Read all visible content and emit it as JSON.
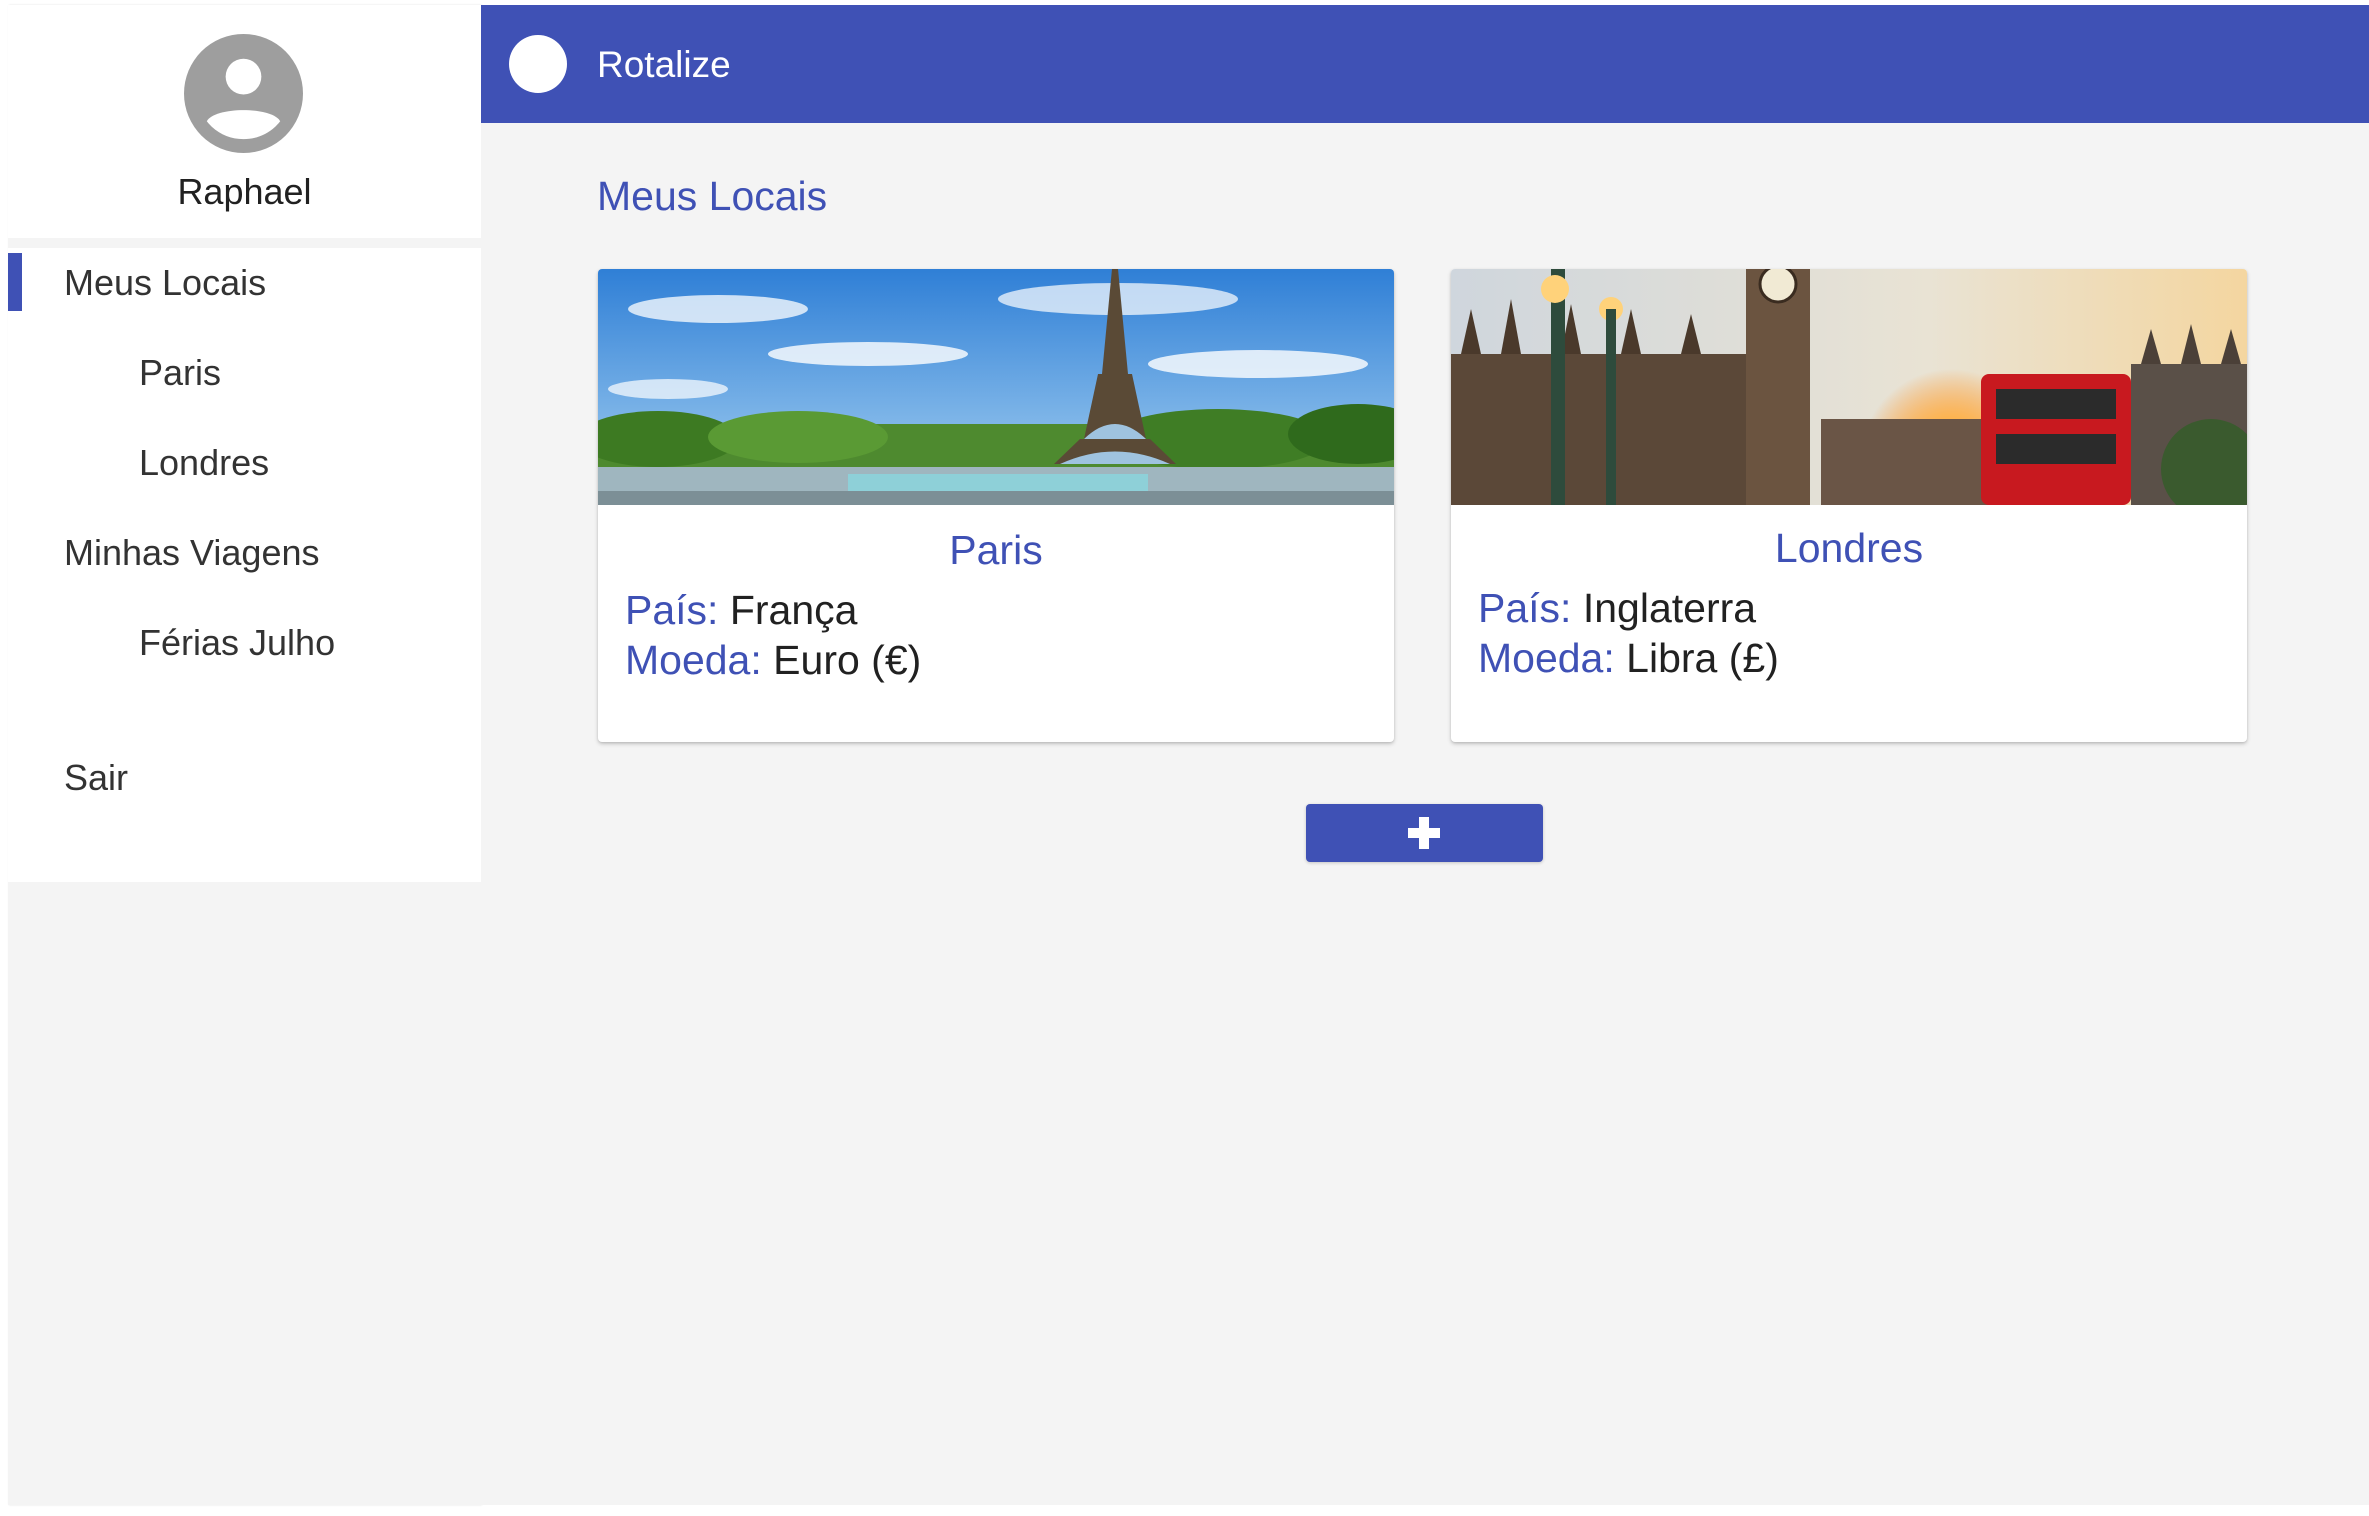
{
  "profile": {
    "name": "Raphael",
    "avatar_icon": "account-circle-icon"
  },
  "sidebar": {
    "items": [
      {
        "label": "Meus Locais",
        "level": 1,
        "active": true
      },
      {
        "label": "Paris",
        "level": 2
      },
      {
        "label": "Londres",
        "level": 2
      },
      {
        "label": "Minhas Viagens",
        "level": 1
      },
      {
        "label": "Férias Julho",
        "level": 2
      },
      {
        "label": "Sair",
        "level": 1
      }
    ]
  },
  "header": {
    "title": "Rotalize",
    "logo_icon": "circle-logo-icon"
  },
  "main": {
    "title": "Meus Locais",
    "cards": [
      {
        "title": "Paris",
        "country_label": "País:",
        "country": "França",
        "currency_label": "Moeda:",
        "currency": "Euro (€)",
        "image": "eiffel-tower-photo"
      },
      {
        "title": "Londres",
        "country_label": "País:",
        "country": "Inglaterra",
        "currency_label": "Moeda:",
        "currency": "Libra (£)",
        "image": "big-ben-bus-photo"
      }
    ],
    "add_button_icon": "plus-icon"
  },
  "colors": {
    "primary": "#3f51b5",
    "background": "#f4f4f4",
    "surface": "#ffffff",
    "text": "#212121"
  }
}
